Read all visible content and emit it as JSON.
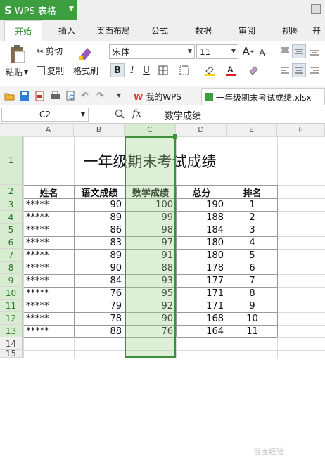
{
  "app": {
    "title": "WPS 表格",
    "logo_glyph": "S"
  },
  "ribbon_tabs": [
    {
      "label": "开始",
      "active": true
    },
    {
      "label": "插入"
    },
    {
      "label": "页面布局"
    },
    {
      "label": "公式"
    },
    {
      "label": "数据"
    },
    {
      "label": "审阅"
    },
    {
      "label": "视图"
    },
    {
      "label": "开"
    }
  ],
  "toolbar": {
    "paste_label": "粘贴",
    "cut_label": "剪切",
    "copy_label": "复制",
    "format_painter_label": "格式刷",
    "font_name": "宋体",
    "font_size": "11",
    "bold_glyph": "B",
    "italic_glyph": "I",
    "underline_glyph": "U",
    "grow_glyph": "A",
    "shrink_glyph": "A"
  },
  "doc_tabs": [
    {
      "label": "我的WPS"
    },
    {
      "label": "一年级期末考试成绩.xlsx",
      "active": true
    }
  ],
  "formula_bar": {
    "cell_ref": "C2",
    "fx_label": "fx",
    "content": "数学成绩"
  },
  "columns": [
    "A",
    "B",
    "C",
    "D",
    "E",
    "F"
  ],
  "selected_column": "C",
  "row_numbers": [
    "1",
    "2",
    "3",
    "4",
    "5",
    "6",
    "7",
    "8",
    "9",
    "10",
    "11",
    "12",
    "13",
    "14",
    "15"
  ],
  "sheet": {
    "title": "一年级期末考试成绩",
    "headers": [
      "姓名",
      "语文成绩",
      "数学成绩",
      "总分",
      "排名"
    ],
    "rows": [
      [
        "*****",
        "90",
        "100",
        "190",
        "1"
      ],
      [
        "*****",
        "89",
        "99",
        "188",
        "2"
      ],
      [
        "*****",
        "86",
        "98",
        "184",
        "3"
      ],
      [
        "*****",
        "83",
        "97",
        "180",
        "4"
      ],
      [
        "*****",
        "89",
        "91",
        "180",
        "5"
      ],
      [
        "*****",
        "90",
        "88",
        "178",
        "6"
      ],
      [
        "*****",
        "84",
        "93",
        "177",
        "7"
      ],
      [
        "*****",
        "76",
        "95",
        "171",
        "8"
      ],
      [
        "*****",
        "79",
        "92",
        "171",
        "9"
      ],
      [
        "*****",
        "78",
        "90",
        "168",
        "10"
      ],
      [
        "*****",
        "88",
        "76",
        "164",
        "11"
      ]
    ]
  },
  "watermark": "百度经验",
  "colors": {
    "accent": "#3d9e40",
    "selection": "#d7ecd0",
    "selection_border": "#3f8f3a"
  }
}
